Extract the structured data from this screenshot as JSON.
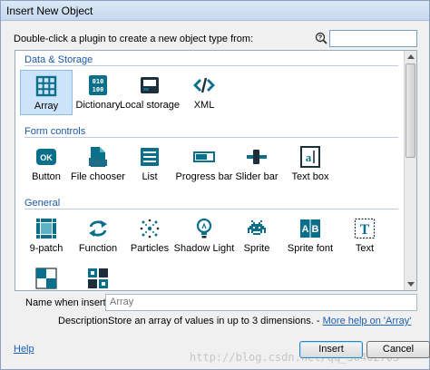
{
  "window": {
    "title": "Insert New Object"
  },
  "instruction": "Double-click a plugin to create a new object type from:",
  "search": {
    "value": ""
  },
  "colors": {
    "icon": "#0a6f8a",
    "category": "#1b59a8",
    "selection": "#cde3fa",
    "link": "#1a5fb4"
  },
  "categories": [
    {
      "label": "Data & Storage",
      "items": [
        {
          "label": "Array",
          "icon": "array-icon",
          "selected": true
        },
        {
          "label": "Dictionary",
          "icon": "dictionary-icon"
        },
        {
          "label": "Local storage",
          "icon": "local-storage-icon"
        },
        {
          "label": "XML",
          "icon": "xml-icon"
        }
      ]
    },
    {
      "label": "Form controls",
      "items": [
        {
          "label": "Button",
          "icon": "button-icon"
        },
        {
          "label": "File chooser",
          "icon": "file-chooser-icon"
        },
        {
          "label": "List",
          "icon": "list-icon"
        },
        {
          "label": "Progress bar",
          "icon": "progress-bar-icon"
        },
        {
          "label": "Slider bar",
          "icon": "slider-bar-icon"
        },
        {
          "label": "Text box",
          "icon": "text-box-icon"
        }
      ]
    },
    {
      "label": "General",
      "items": [
        {
          "label": "9-patch",
          "icon": "nine-patch-icon"
        },
        {
          "label": "Function",
          "icon": "function-icon"
        },
        {
          "label": "Particles",
          "icon": "particles-icon"
        },
        {
          "label": "Shadow Light",
          "icon": "shadow-light-icon"
        },
        {
          "label": "Sprite",
          "icon": "sprite-icon"
        },
        {
          "label": "Sprite font",
          "icon": "sprite-font-icon"
        },
        {
          "label": "Text",
          "icon": "text-icon"
        }
      ]
    }
  ],
  "footer": {
    "name_label": "Name when inserted:",
    "name_value": "Array",
    "desc_label": "Description:",
    "desc_text": "Store an array of values in up to 3 dimensions. - ",
    "desc_link": "More help on 'Array'",
    "help": "Help",
    "insert": "Insert",
    "cancel": "Cancel"
  },
  "watermark": "http://blog.csdn.net/qq_30402703"
}
